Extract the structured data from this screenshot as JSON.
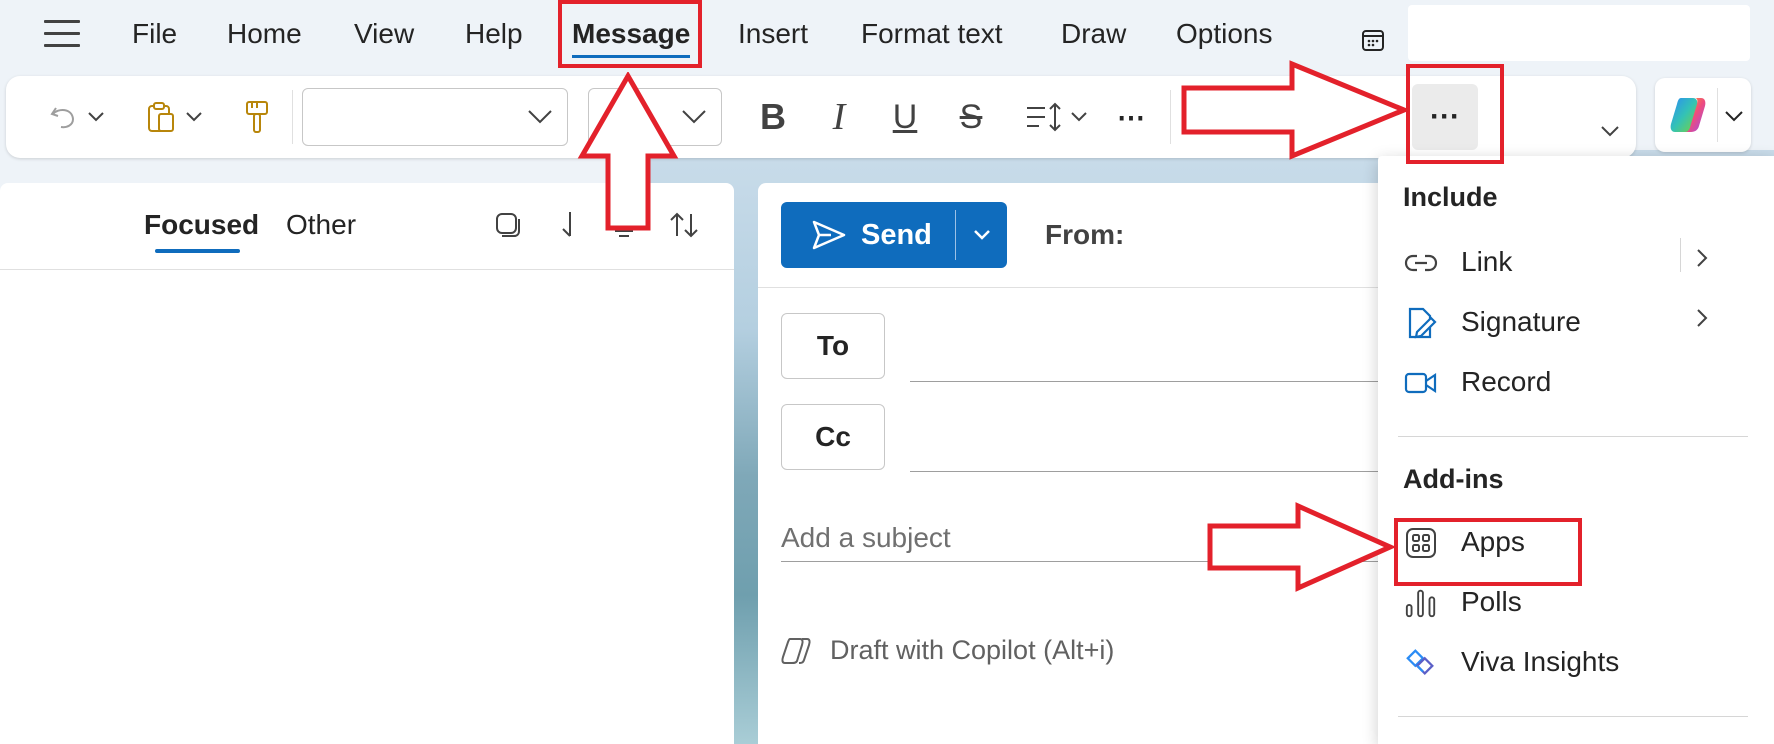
{
  "menubar": {
    "tabs": [
      "File",
      "Home",
      "View",
      "Help",
      "Message",
      "Insert",
      "Format text",
      "Draw",
      "Options"
    ],
    "active_tab": "Message"
  },
  "ribbon": {
    "font_name": "",
    "font_size": ""
  },
  "mail_list": {
    "tab_focused": "Focused",
    "tab_other": "Other"
  },
  "compose": {
    "send_label": "Send",
    "from_label": "From:",
    "to_label": "To",
    "cc_label": "Cc",
    "subject_placeholder": "Add a subject",
    "copilot_draft": "Draft with Copilot (Alt+i)"
  },
  "more_menu": {
    "include_heading": "Include",
    "items_include": [
      {
        "label": "Link",
        "icon": "link-icon",
        "has_submenu": true
      },
      {
        "label": "Signature",
        "icon": "signature-icon",
        "has_submenu": true
      },
      {
        "label": "Record",
        "icon": "video-icon",
        "has_submenu": false
      }
    ],
    "addins_heading": "Add-ins",
    "items_addins": [
      {
        "label": "Apps",
        "icon": "apps-grid-icon"
      },
      {
        "label": "Polls",
        "icon": "polls-icon"
      },
      {
        "label": "Viva Insights",
        "icon": "viva-insights-icon"
      }
    ]
  },
  "colors": {
    "accent": "#0f6cbd",
    "annotation_red": "#e3212b"
  }
}
